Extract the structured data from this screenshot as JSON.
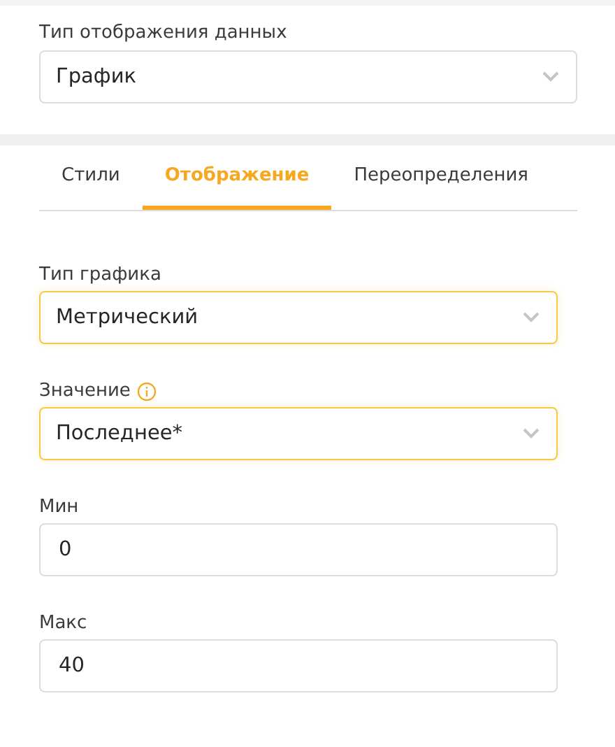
{
  "display_type": {
    "label": "Тип отображения данных",
    "value": "График"
  },
  "tabs": [
    {
      "label": "Стили",
      "selected": false
    },
    {
      "label": "Отображение",
      "selected": true
    },
    {
      "label": "Переопределения",
      "selected": false
    }
  ],
  "fields": [
    {
      "kind": "select",
      "label": "Тип графика",
      "value": "Метрический",
      "highlighted": true,
      "info": false
    },
    {
      "kind": "select",
      "label": "Значение",
      "value": "Последнее*",
      "highlighted": true,
      "info": true
    },
    {
      "kind": "input",
      "label": "Мин",
      "value": "0",
      "highlighted": false,
      "info": false
    },
    {
      "kind": "input",
      "label": "Макс",
      "value": "40",
      "highlighted": false,
      "info": false
    }
  ]
}
